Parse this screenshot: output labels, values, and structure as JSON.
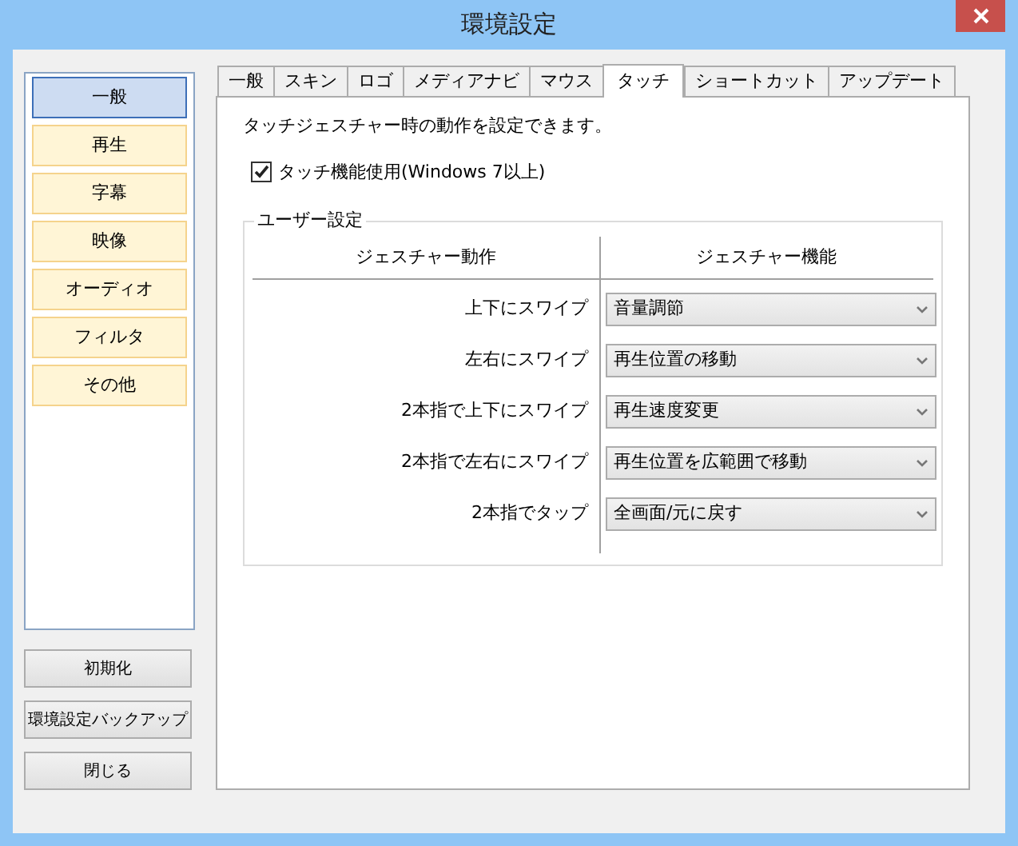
{
  "window": {
    "title": "環境設定"
  },
  "categories": [
    {
      "label": "一般",
      "selected": true
    },
    {
      "label": "再生",
      "selected": false
    },
    {
      "label": "字幕",
      "selected": false
    },
    {
      "label": "映像",
      "selected": false
    },
    {
      "label": "オーディオ",
      "selected": false
    },
    {
      "label": "フィルタ",
      "selected": false
    },
    {
      "label": "その他",
      "selected": false
    }
  ],
  "buttons": [
    "初期化",
    "環境設定バックアップ",
    "閉じる"
  ],
  "tabs": [
    {
      "label": "一般",
      "selected": false
    },
    {
      "label": "スキン",
      "selected": false
    },
    {
      "label": "ロゴ",
      "selected": false
    },
    {
      "label": "メディアナビ",
      "selected": false
    },
    {
      "label": "マウス",
      "selected": false
    },
    {
      "label": "タッチ",
      "selected": true
    },
    {
      "label": "ショートカット",
      "selected": false
    },
    {
      "label": "アップデート",
      "selected": false
    }
  ],
  "description": "タッチジェスチャー時の動作を設定できます。",
  "touch_enabled": {
    "label": "タッチ機能使用(Windows 7以上)",
    "checked": true
  },
  "user_settings": {
    "title": "ユーザー設定",
    "columns": [
      "ジェスチャー動作",
      "ジェスチャー機能"
    ],
    "rows": [
      {
        "gesture": "上下にスワイプ",
        "function": "音量調節"
      },
      {
        "gesture": "左右にスワイプ",
        "function": "再生位置の移動"
      },
      {
        "gesture": "2本指で上下にスワイプ",
        "function": "再生速度変更"
      },
      {
        "gesture": "2本指で左右にスワイプ",
        "function": "再生位置を広範囲で移動"
      },
      {
        "gesture": "2本指でタップ",
        "function": "全画面/元に戻す"
      }
    ]
  }
}
